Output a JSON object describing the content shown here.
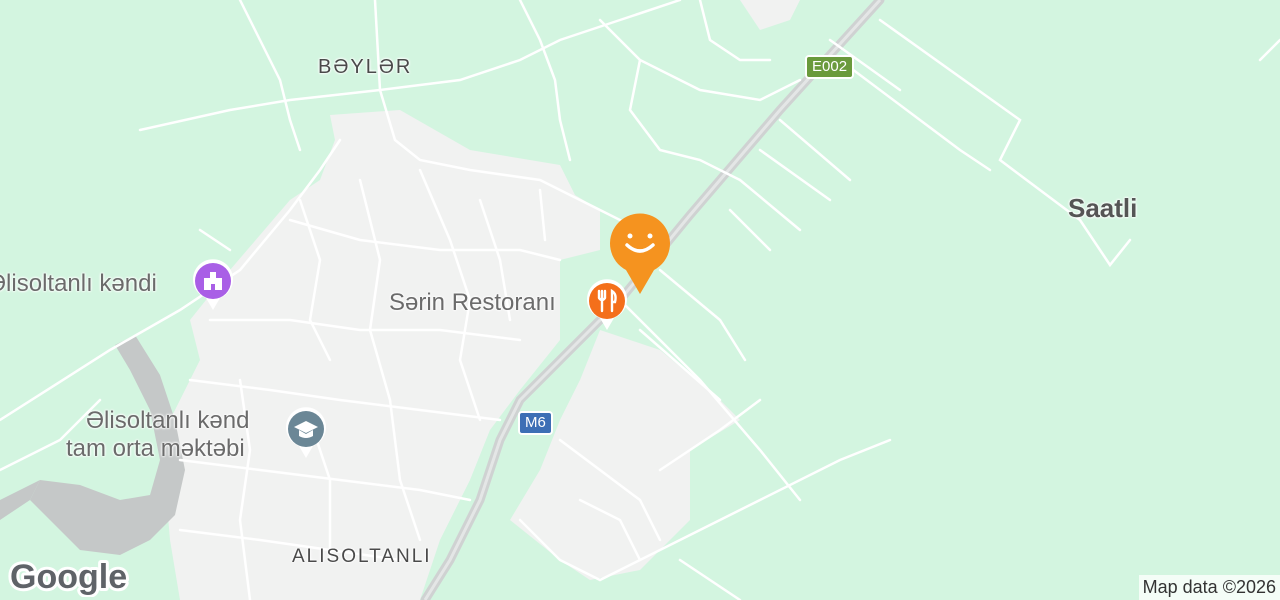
{
  "map": {
    "colors": {
      "land": "#d3f5e0",
      "urban": "#f1f2f1",
      "road": "#ffffff",
      "highway": "#cfd2d2",
      "water": "#c5c8c8"
    },
    "labels": {
      "beyler": "BƏYLƏR",
      "alisoltanli": "ALISOLTANLI",
      "saatli": "Saatli",
      "alisoltanli_kendi": "Əlisoltanlı kəndi",
      "school_line1": "Əlisoltanlı kənd",
      "school_line2": "tam orta məktəbi",
      "restaurant": "Sərin Restoranı"
    },
    "shields": {
      "e002": "E002",
      "m6": "M6"
    },
    "pins": [
      {
        "name": "Əlisoltanlı kəndi",
        "icon": "landmark-icon",
        "color": "#a95fe6"
      },
      {
        "name": "Əlisoltanlı kənd tam orta məktəbi",
        "icon": "school-icon",
        "color": "#6b8796"
      },
      {
        "name": "Sərin Restoranı",
        "icon": "restaurant-icon",
        "color": "#f46f1b"
      },
      {
        "name": "Selected location",
        "icon": "smiley-icon",
        "color": "#f5931f"
      }
    ],
    "logo": "Google",
    "attribution": "Map data ©2026"
  }
}
